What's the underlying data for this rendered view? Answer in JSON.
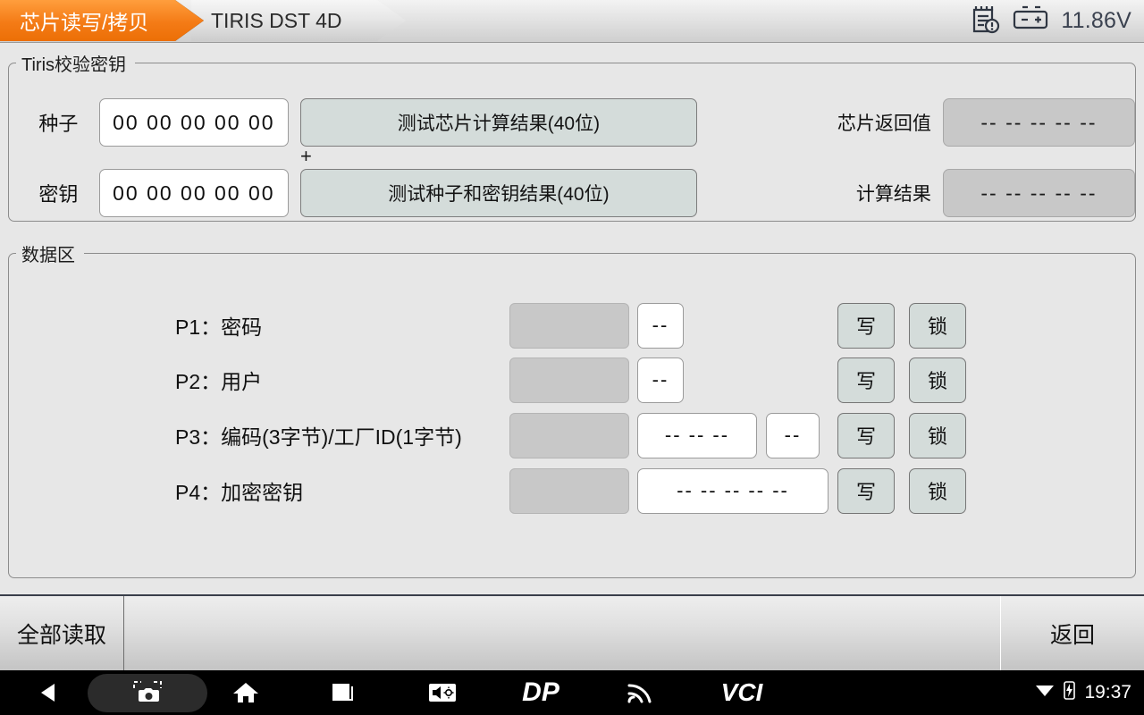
{
  "topbar": {
    "tabs": [
      {
        "label": "芯片读写/拷贝",
        "active": true
      },
      {
        "label": "TIRIS DST 4D",
        "active": false
      }
    ],
    "report_icon": "report-alert-icon",
    "battery_icon": "battery-icon",
    "voltage": "11.86V"
  },
  "key_group": {
    "legend": "Tiris校验密钥",
    "plus_sign": "+",
    "rows": [
      {
        "label": "种子",
        "input_value": "00  00  00  00  00",
        "button_label": "测试芯片计算结果(40位)",
        "result_label": "芯片返回值",
        "result_value": "--  --  --  --  --"
      },
      {
        "label": "密钥",
        "input_value": "00  00  00  00  00",
        "button_label": "测试种子和密钥结果(40位)",
        "result_label": "计算结果",
        "result_value": "--  --  --  --  --"
      }
    ]
  },
  "data_group": {
    "legend": "数据区",
    "write_label": "写",
    "lock_label": "锁",
    "rows": [
      {
        "label": "P1：密码",
        "value": "--",
        "extra": ""
      },
      {
        "label": "P2：用户",
        "value": "--",
        "extra": ""
      },
      {
        "label": "P3：编码(3字节)/工厂ID(1字节)",
        "value": "--  --  --",
        "extra": "--"
      },
      {
        "label": "P4：加密密钥",
        "value": "--  --  --  --  --",
        "extra": ""
      }
    ]
  },
  "action_bar": {
    "read_all": "全部读取",
    "back": "返回"
  },
  "navbar": {
    "back_icon": "back-triangle-icon",
    "screenshot_icon": "screenshot-camera-icon",
    "home_icon": "home-icon",
    "recents_icon": "recents-square-icon",
    "volume_icon": "volume-brightness-icon",
    "dp_logo": "DP",
    "signal_icon": "signal-wifi-icon",
    "vci_logo": "VCI",
    "status_wifi_icon": "wifi-icon",
    "status_battery_icon": "battery-charging-icon",
    "clock": "19:37"
  }
}
